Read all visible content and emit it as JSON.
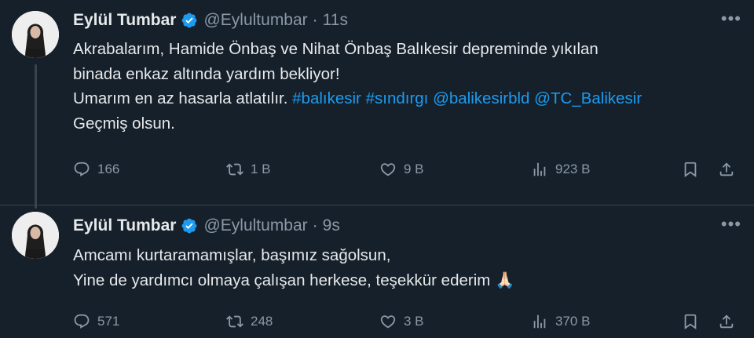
{
  "tweets": [
    {
      "author_name": "Eylül Tumbar",
      "handle": "@Eylultumbar",
      "separator": "·",
      "time": "11s",
      "lines": [
        "Akrabalarım, Hamide Önbaş ve Nihat Önbaş Balıkesir depreminde yıkılan",
        "binada enkaz altında yardım bekliyor!",
        "Umarım en az hasarla atlatılır.",
        "Geçmiş olsun."
      ],
      "hashtags": [
        "#balıkesir",
        "#sındırgı"
      ],
      "mentions": [
        "@balikesirbld",
        "@TC_Balikesir"
      ],
      "replies": "166",
      "retweets": "1 B",
      "likes": "9 B",
      "views": "923 B"
    },
    {
      "author_name": "Eylül Tumbar",
      "handle": "@Eylultumbar",
      "separator": "·",
      "time": "9s",
      "lines": [
        "Amcamı kurtaramamışlar, başımız sağolsun,",
        "Yine de yardımcı olmaya çalışan herkese, teşekkür ederim"
      ],
      "emoji": "🙏🏻",
      "replies": "571",
      "retweets": "248",
      "likes": "3 B",
      "views": "370 B"
    }
  ],
  "colors": {
    "background": "#15202b",
    "text": "#e7e9ea",
    "secondary": "#8b98a5",
    "link": "#1d9bf0",
    "verified": "#1d9bf0"
  },
  "icons": [
    "avatar",
    "verified-badge-icon",
    "more-icon",
    "reply-icon",
    "retweet-icon",
    "like-icon",
    "views-icon",
    "bookmark-icon",
    "share-icon"
  ]
}
